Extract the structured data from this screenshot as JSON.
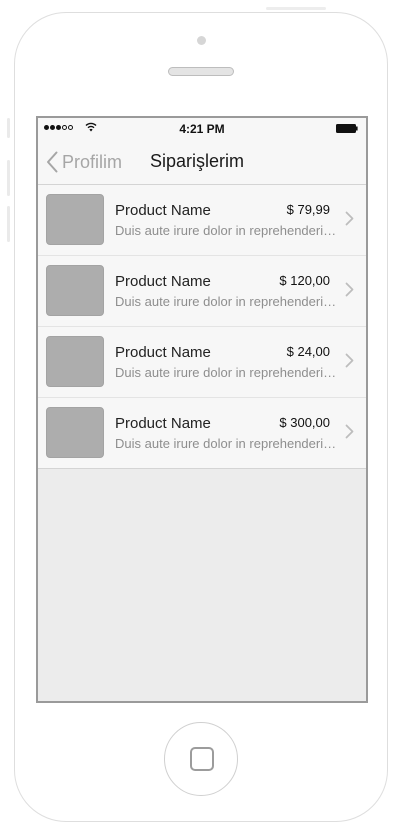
{
  "status_bar": {
    "time": "4:21 PM",
    "signal_dots_filled": 3,
    "signal_dots_total": 5
  },
  "nav": {
    "back_label": "Profilim",
    "title": "Siparişlerim",
    "back_icon": "chevron-left-icon"
  },
  "orders": [
    {
      "name": "Product Name",
      "price": "$ 79,99",
      "description": "Duis aute irure dolor in reprehenderit in voluptate"
    },
    {
      "name": "Product Name",
      "price": "$ 120,00",
      "description": "Duis aute irure dolor in reprehenderit in voluptate"
    },
    {
      "name": "Product Name",
      "price": "$ 24,00",
      "description": "Duis aute irure dolor in reprehenderit in voluptate"
    },
    {
      "name": "Product Name",
      "price": "$ 300,00",
      "description": "Duis aute irure dolor in reprehenderit in voluptate"
    }
  ],
  "colors": {
    "nav_background": "#f7f7f7",
    "screen_background": "#ececec",
    "thumbnail": "#adadad",
    "back_label": "#a6a6a6"
  }
}
